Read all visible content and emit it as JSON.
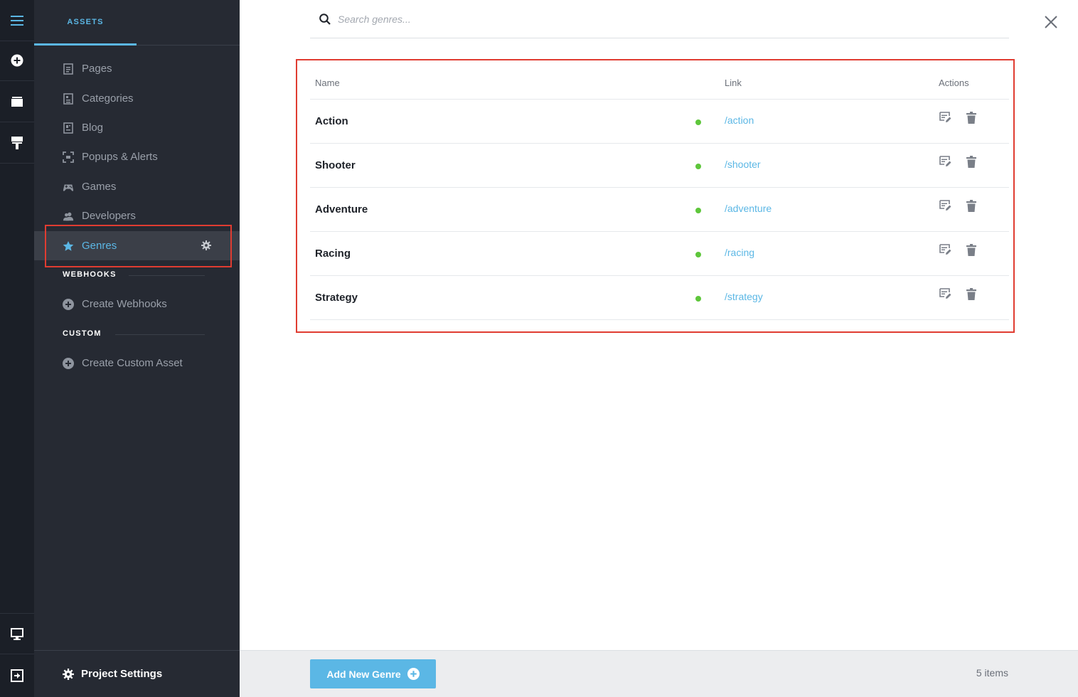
{
  "rail": {
    "icons": [
      "hamburger-menu-icon",
      "add-circle-icon",
      "folder-icon",
      "paint-roller-icon",
      "monitor-icon",
      "exit-icon"
    ]
  },
  "sidebar": {
    "tab_label": "ASSETS",
    "items": [
      {
        "label": "Pages",
        "icon": "page-icon"
      },
      {
        "label": "Categories",
        "icon": "category-icon"
      },
      {
        "label": "Blog",
        "icon": "blog-icon"
      },
      {
        "label": "Popups & Alerts",
        "icon": "popup-icon"
      },
      {
        "label": "Games",
        "icon": "gamepad-icon"
      },
      {
        "label": "Developers",
        "icon": "users-icon"
      },
      {
        "label": "Genres",
        "icon": "star-icon",
        "active": true
      }
    ],
    "webhooks": {
      "label": "WEBHOOKS",
      "create": "Create Webhooks"
    },
    "custom": {
      "label": "CUSTOM",
      "create": "Create Custom Asset"
    },
    "footer_label": "Project Settings"
  },
  "search": {
    "placeholder": "Search genres..."
  },
  "table": {
    "columns": {
      "name": "Name",
      "link": "Link",
      "actions": "Actions"
    },
    "rows": [
      {
        "name": "Action",
        "link": "/action",
        "status": "published"
      },
      {
        "name": "Shooter",
        "link": "/shooter",
        "status": "published"
      },
      {
        "name": "Adventure",
        "link": "/adventure",
        "status": "published"
      },
      {
        "name": "Racing",
        "link": "/racing",
        "status": "published"
      },
      {
        "name": "Strategy",
        "link": "/strategy",
        "status": "published"
      }
    ]
  },
  "footer": {
    "add_label": "Add New Genre",
    "count": "5 items"
  },
  "colors": {
    "accent": "#5bb7e5",
    "status_green": "#5ec63b",
    "highlight": "#e03c31",
    "sidebar_bg": "#262a33",
    "rail_bg": "#1b1f27"
  }
}
